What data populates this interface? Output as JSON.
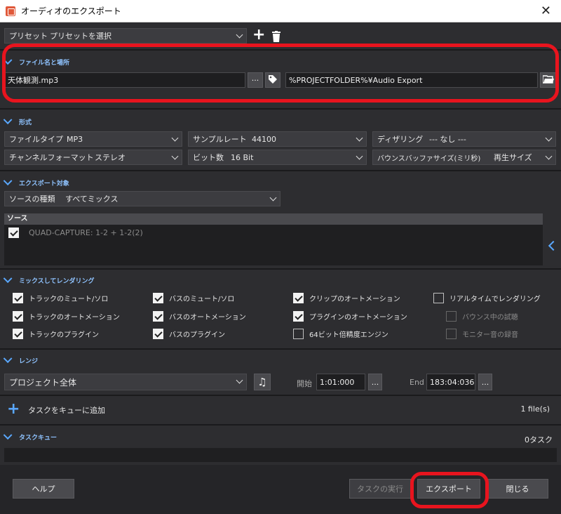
{
  "window": {
    "title": "オーディオのエクスポート",
    "close": "✕"
  },
  "preset": {
    "label": "プリセット",
    "value": "プリセットを選択",
    "add": "+"
  },
  "file_section": {
    "header": "ファイル名と場所",
    "filename": "天体観測.mp3",
    "more": "···",
    "path": "%PROJECTFOLDER%¥Audio Export"
  },
  "format_section": {
    "header": "形式",
    "file_type": {
      "label": "ファイルタイプ",
      "value": "MP3"
    },
    "sample_rate": {
      "label": "サンプルレート",
      "value": "44100"
    },
    "dither": {
      "label": "ディザリング",
      "value": "--- なし ---"
    },
    "channel": {
      "label": "チャンネルフォーマット",
      "value": "ステレオ"
    },
    "bit_depth": {
      "label": "ビット数",
      "value": "16 Bit"
    },
    "bounce_buffer": {
      "label": "バウンスバッファサイズ(ミリ秒)",
      "value": "再生サイズ"
    }
  },
  "export_section": {
    "header": "エクスポート対象",
    "source_type": {
      "label": "ソースの種類",
      "value": "すべてミックス"
    },
    "source_header": "ソース",
    "sources": [
      {
        "name": "QUAD-CAPTURE: 1-2 + 1-2(2)",
        "checked": true
      }
    ]
  },
  "mix_section": {
    "header": "ミックスしてレンダリング",
    "options": [
      {
        "label": "トラックのミュート/ソロ",
        "checked": true
      },
      {
        "label": "バスのミュート/ソロ",
        "checked": true
      },
      {
        "label": "クリップのオートメーション",
        "checked": true
      },
      {
        "label": "リアルタイムでレンダリング",
        "checked": false
      },
      {
        "label": "トラックのオートメーション",
        "checked": true
      },
      {
        "label": "バスのオートメーション",
        "checked": true
      },
      {
        "label": "プラグインのオートメーション",
        "checked": true
      },
      {
        "label": "バウンス中の試聴",
        "checked": false
      },
      {
        "label": "トラックのプラグイン",
        "checked": true
      },
      {
        "label": "バスのプラグイン",
        "checked": true
      },
      {
        "label": "64ビット倍精度エンジン",
        "checked": false
      },
      {
        "label": "モニター音の録音",
        "checked": false
      }
    ]
  },
  "range_section": {
    "header": "レンジ",
    "range_value": "プロジェクト全体",
    "start_label": "開始",
    "start_value": "1:01:000",
    "end_label": "End",
    "end_value": "183:04:036",
    "more": "..."
  },
  "task_add": {
    "label": "タスクをキューに追加",
    "count": "1 file(s)"
  },
  "task_queue": {
    "header": "タスクキュー",
    "count": "0タスク"
  },
  "footer": {
    "help": "ヘルプ",
    "run_tasks": "タスクの実行",
    "export": "エクスポート",
    "close": "閉じる"
  }
}
